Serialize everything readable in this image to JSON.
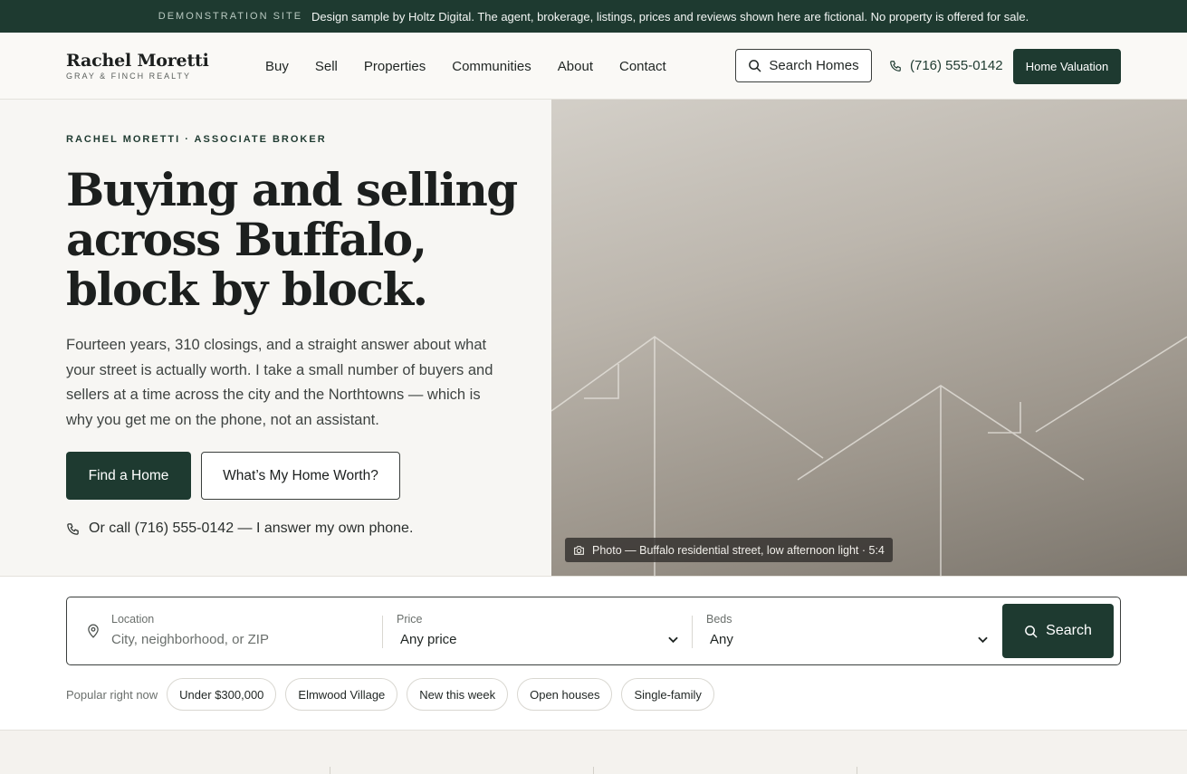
{
  "demo_bar": {
    "tag": "DEMONSTRATION SITE",
    "text": "Design sample by Holtz Digital. The agent, brokerage, listings, prices and reviews shown here are fictional. No property is offered for sale."
  },
  "header": {
    "brand_name": "Rachel Moretti",
    "brand_sub": "GRAY & FINCH REALTY",
    "nav": [
      "Buy",
      "Sell",
      "Properties",
      "Communities",
      "About",
      "Contact"
    ],
    "search_homes_label": "Search Homes",
    "phone": "(716) 555-0142",
    "valuation_label": "Home Valuation"
  },
  "hero": {
    "eyebrow": "RACHEL MORETTI · ASSOCIATE BROKER",
    "headline": "Buying and selling across Buffalo, block by block.",
    "intro": "Fourteen years, 310 closings, and a straight answer about what your street is actually worth. I take a small number of buyers and sellers at a time across the city and the Northtowns — which is why you get me on the phone, not an assistant.",
    "primary_cta": "Find a Home",
    "secondary_cta": "What’s My Home Worth?",
    "call_line": "Or call (716) 555-0142 — I answer my own phone.",
    "photo_caption": "Photo — Buffalo residential street, low afternoon light · 5:4"
  },
  "search": {
    "location_label": "Location",
    "location_placeholder": "City, neighborhood, or ZIP",
    "price_label": "Price",
    "price_value": "Any price",
    "beds_label": "Beds",
    "beds_value": "Any",
    "submit_label": "Search",
    "popular_label": "Popular right now",
    "chips": [
      "Under $300,000",
      "Elmwood Village",
      "New this week",
      "Open houses",
      "Single-family"
    ]
  },
  "colors": {
    "brand_green": "#1e3a30",
    "page_bg": "#faf9f6"
  }
}
